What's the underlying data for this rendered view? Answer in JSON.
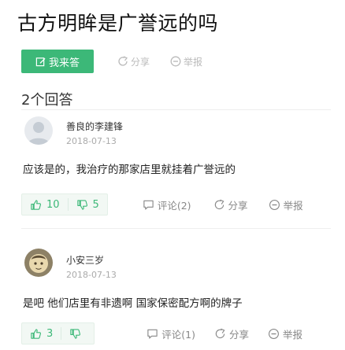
{
  "question": {
    "title": "古方明眸是广誉远的吗"
  },
  "actions": {
    "answer_label": "我来答",
    "share_label": "分享",
    "report_label": "举报"
  },
  "answers_header": {
    "count_label": "2个回答"
  },
  "answers": [
    {
      "author": "善良的李建锋",
      "date": "2018-07-13",
      "text": "应该是的，我治疗的那家店里就挂着广誉远的",
      "likes": "10",
      "dislikes": "5",
      "comment_label": "评论(2)",
      "share_label": "分享",
      "report_label": "举报"
    },
    {
      "author": "小安三岁",
      "date": "2018-07-13",
      "text": "是吧 他们店里有非遗啊 国家保密配方啊的牌子",
      "likes": "3",
      "dislikes": "",
      "comment_label": "评论(1)",
      "share_label": "分享",
      "report_label": "举报"
    }
  ],
  "colors": {
    "accent": "#3cb878",
    "muted_text": "#aaaaaa",
    "divider": "#eeeeee"
  }
}
